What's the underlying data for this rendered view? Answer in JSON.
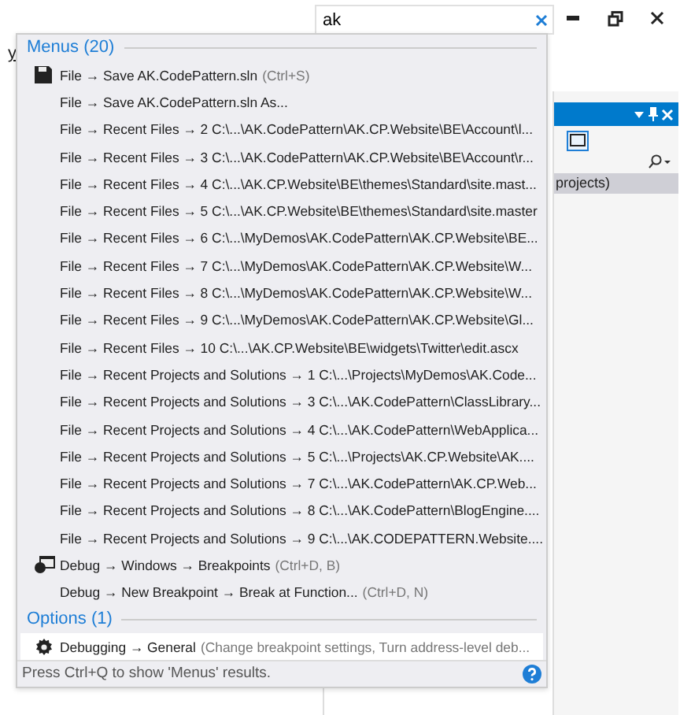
{
  "search": {
    "value": "ak"
  },
  "background": {
    "left_fragment": "y",
    "panel_row": "projects)"
  },
  "results": {
    "groups": [
      {
        "title": "Menus (20)",
        "items": [
          {
            "text": "File → Save AK.CodePattern.sln",
            "shortcut": "(Ctrl+S)",
            "kind": "save",
            "selected": false
          },
          {
            "text": "File → Save AK.CodePattern.sln As...",
            "selected": false
          },
          {
            "text": "File → Recent Files → 2 C:\\...\\AK.CodePattern\\AK.CP.Website\\BE\\Account\\l...",
            "selected": false
          },
          {
            "text": "File → Recent Files → 3 C:\\...\\AK.CodePattern\\AK.CP.Website\\BE\\Account\\r...",
            "selected": false
          },
          {
            "text": "File → Recent Files → 4 C:\\...\\AK.CP.Website\\BE\\themes\\Standard\\site.mast...",
            "selected": false
          },
          {
            "text": "File → Recent Files → 5 C:\\...\\AK.CP.Website\\BE\\themes\\Standard\\site.master",
            "selected": false
          },
          {
            "text": "File → Recent Files → 6 C:\\...\\MyDemos\\AK.CodePattern\\AK.CP.Website\\BE...",
            "selected": false
          },
          {
            "text": "File → Recent Files → 7 C:\\...\\MyDemos\\AK.CodePattern\\AK.CP.Website\\W...",
            "selected": false
          },
          {
            "text": "File → Recent Files → 8 C:\\...\\MyDemos\\AK.CodePattern\\AK.CP.Website\\W...",
            "selected": false
          },
          {
            "text": "File → Recent Files → 9 C:\\...\\MyDemos\\AK.CodePattern\\AK.CP.Website\\Gl...",
            "selected": false
          },
          {
            "text": "File → Recent Files → 10 C:\\...\\AK.CP.Website\\BE\\widgets\\Twitter\\edit.ascx",
            "selected": false
          },
          {
            "text": "File → Recent Projects and Solutions → 1 C:\\...\\Projects\\MyDemos\\AK.Code...",
            "selected": false
          },
          {
            "text": "File → Recent Projects and Solutions → 3 C:\\...\\AK.CodePattern\\ClassLibrary...",
            "selected": false
          },
          {
            "text": "File → Recent Projects and Solutions → 4 C:\\...\\AK.CodePattern\\WebApplica...",
            "selected": false
          },
          {
            "text": "File → Recent Projects and Solutions → 5 C:\\...\\Projects\\AK.CP.Website\\AK....",
            "selected": false
          },
          {
            "text": "File → Recent Projects and Solutions → 7 C:\\...\\AK.CodePattern\\AK.CP.Web...",
            "selected": false
          },
          {
            "text": "File → Recent Projects and Solutions → 8 C:\\...\\AK.CodePattern\\BlogEngine....",
            "selected": false
          },
          {
            "text": "File → Recent Projects and Solutions → 9 C:\\...\\AK.CODEPATTERN.Website....",
            "selected": false
          },
          {
            "text": "Debug → Windows → Breakpoints",
            "shortcut": "(Ctrl+D, B)",
            "kind": "breakpoints",
            "selected": false
          },
          {
            "text": "Debug → New Breakpoint → Break at Function...",
            "shortcut": "(Ctrl+D, N)",
            "selected": false
          }
        ]
      },
      {
        "title": "Options (1)",
        "items": [
          {
            "text": "Debugging → General",
            "shortcut": "(Change breakpoint settings, Turn address-level deb...",
            "kind": "settings",
            "selected": true
          }
        ]
      }
    ],
    "footer": "Press Ctrl+Q to show 'Menus' results."
  }
}
